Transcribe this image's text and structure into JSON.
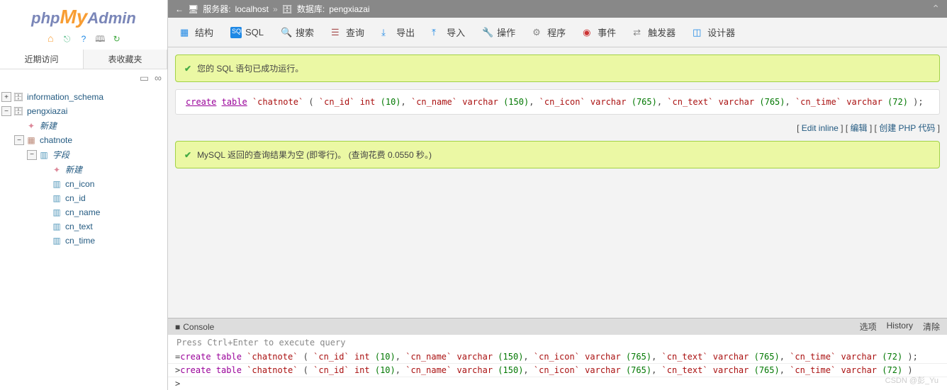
{
  "logo": {
    "php": "php",
    "my": "My",
    "admin": "Admin"
  },
  "sideTabs": {
    "recent": "近期访问",
    "favorites": "表收藏夹"
  },
  "tree": {
    "db1": "information_schema",
    "db2": "pengxiazai",
    "new1": "新建",
    "table1": "chatnote",
    "cols_label": "字段",
    "new2": "新建",
    "col1": "cn_icon",
    "col2": "cn_id",
    "col3": "cn_name",
    "col4": "cn_text",
    "col5": "cn_time"
  },
  "breadcrumb": {
    "server_label": "服务器:",
    "server": "localhost",
    "sep": "»",
    "db_label": "数据库:",
    "db": "pengxiazai"
  },
  "menu": {
    "structure": "结构",
    "sql": "SQL",
    "search": "搜索",
    "query": "查询",
    "export": "导出",
    "import": "导入",
    "operations": "操作",
    "routines": "程序",
    "events": "事件",
    "triggers": "触发器",
    "designer": "设计器"
  },
  "messages": {
    "success1": "您的 SQL 语句已成功运行。",
    "success2": "MySQL 返回的查询结果为空 (即零行)。 (查询花费 0.0550 秒。)"
  },
  "sql": {
    "create": "create",
    "table": "table",
    "tblname": "`chatnote`",
    "open": " ( ",
    "c1": "`cn_id`",
    "t1": "int",
    "n1": "(10)",
    "c2": "`cn_name`",
    "t2": "varchar",
    "n2": "(150)",
    "c3": "`cn_icon`",
    "t3": "varchar",
    "n3": "(765)",
    "c4": "`cn_text`",
    "t4": "varchar",
    "n4": "(765)",
    "c5": "`cn_time`",
    "t5": "varchar",
    "n5": "(72)",
    "close": " );",
    "close2": " )",
    "comma": ", "
  },
  "actions": {
    "inline": "Edit inline",
    "edit": "编辑",
    "php": "创建 PHP 代码"
  },
  "console": {
    "title": "Console",
    "options": "选项",
    "history": "History",
    "clear": "清除",
    "hint": "Press Ctrl+Enter to execute query",
    "prompt": ">"
  },
  "watermark": "CSDN @彭_Yu"
}
